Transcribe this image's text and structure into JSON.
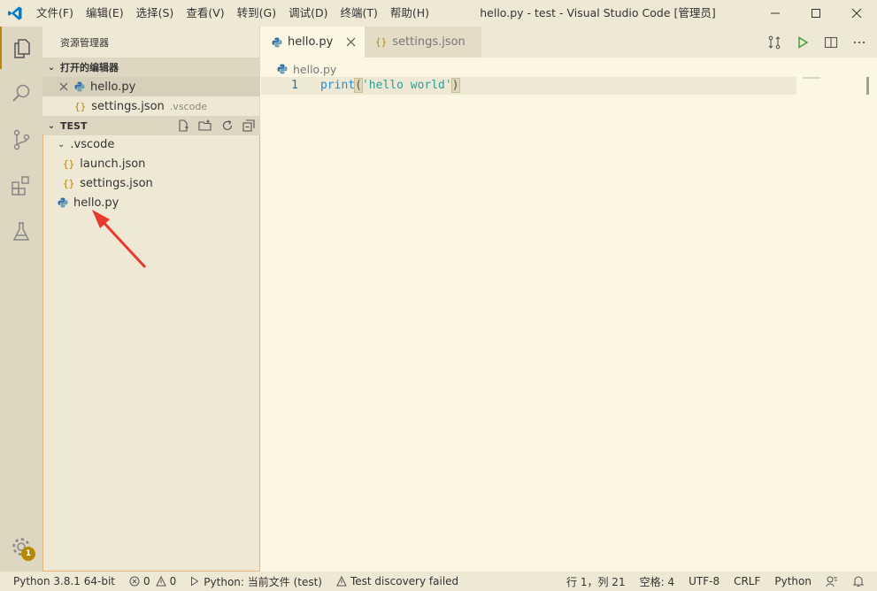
{
  "titlebar": {
    "window_title": "hello.py - test - Visual Studio Code [管理员]",
    "menu": [
      "文件(F)",
      "编辑(E)",
      "选择(S)",
      "查看(V)",
      "转到(G)",
      "调试(D)",
      "终端(T)",
      "帮助(H)"
    ],
    "accent": "#007acc"
  },
  "sidebar": {
    "title": "资源管理器",
    "open_editors_header": "打开的编辑器",
    "open_editors": [
      {
        "name": "hello.py",
        "desc": ""
      },
      {
        "name": "settings.json",
        "desc": ".vscode"
      }
    ],
    "folder_header": "TEST",
    "tree": [
      {
        "name": ".vscode"
      },
      {
        "name": "launch.json"
      },
      {
        "name": "settings.json"
      },
      {
        "name": "hello.py"
      }
    ]
  },
  "activitybar": {
    "icons": [
      "explorer-icon",
      "search-icon",
      "source-control-icon",
      "extensions-icon",
      "test-icon"
    ],
    "settings_badge": "1"
  },
  "editor": {
    "tabs": [
      {
        "label": "hello.py",
        "active": true
      },
      {
        "label": "settings.json",
        "active": false
      }
    ],
    "breadcrumb": "hello.py",
    "lines": [
      {
        "number": "1",
        "keyword": "print",
        "paren_open": "(",
        "string": "'hello world'",
        "paren_close": ")"
      }
    ]
  },
  "statusbar": {
    "interpreter": "Python 3.8.1 64-bit",
    "errors": "0",
    "warnings": "0",
    "run_target": "Python: 当前文件 (test)",
    "test_status": "Test discovery failed",
    "cursor": "行 1，列 21",
    "indent": "空格: 4",
    "encoding": "UTF-8",
    "eol": "CRLF",
    "language": "Python"
  },
  "colors": {
    "background": "#fdf6e3",
    "sidebar": "#eee8d5",
    "accent": "#b58900",
    "keyword": "#268bd2",
    "string": "#2aa198",
    "arrow": "#e8392c"
  }
}
